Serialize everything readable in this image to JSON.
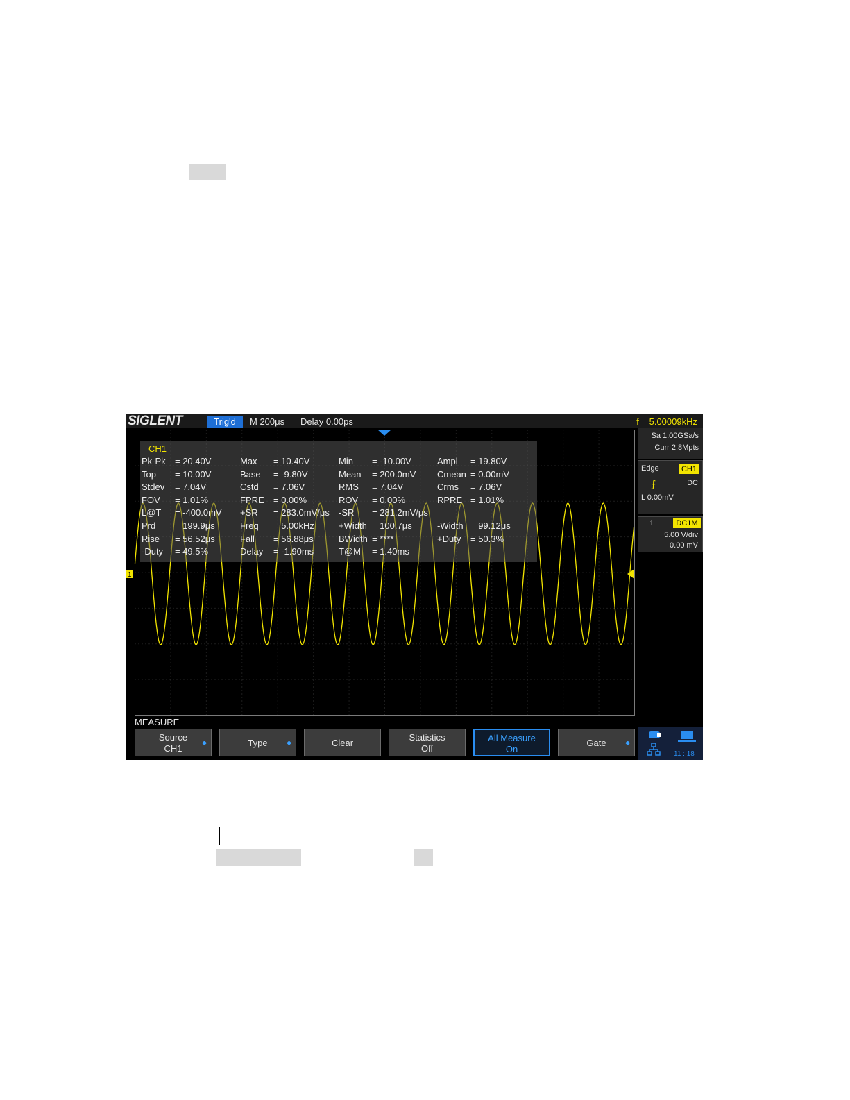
{
  "scope": {
    "logo": "SIGLENT",
    "trig_state": "Trig'd",
    "timebase": "M 200μs",
    "delay": "Delay 0.00ps",
    "frequency": "f = 5.00009kHz",
    "channel_marker": "1",
    "acquisition": {
      "sample_rate": "Sa 1.00GSa/s",
      "memory": "Curr 2.8Mpts"
    },
    "trigger": {
      "type": "Edge",
      "source": "CH1",
      "coupling": "DC",
      "level": "L  0.00mV"
    },
    "channel": {
      "number": "1",
      "coupling": "DC1M",
      "scale": "5.00 V/div",
      "offset": "0.00 mV"
    },
    "measure": {
      "title": "CH1",
      "rows": [
        [
          {
            "label": "Pk-Pk",
            "value": "= 20.40V"
          },
          {
            "label": "Max",
            "value": "= 10.40V"
          },
          {
            "label": "Min",
            "value": "= -10.00V"
          },
          {
            "label": "Ampl",
            "value": "= 19.80V"
          }
        ],
        [
          {
            "label": "Top",
            "value": "= 10.00V"
          },
          {
            "label": "Base",
            "value": "= -9.80V"
          },
          {
            "label": "Mean",
            "value": "= 200.0mV"
          },
          {
            "label": "Cmean",
            "value": "= 0.00mV"
          }
        ],
        [
          {
            "label": "Stdev",
            "value": "= 7.04V"
          },
          {
            "label": "Cstd",
            "value": "= 7.06V"
          },
          {
            "label": "RMS",
            "value": "= 7.04V"
          },
          {
            "label": "Crms",
            "value": "= 7.06V"
          }
        ],
        [
          {
            "label": "FOV",
            "value": "= 1.01%"
          },
          {
            "label": "FPRE",
            "value": "= 0.00%"
          },
          {
            "label": "ROV",
            "value": "= 0.00%"
          },
          {
            "label": "RPRE",
            "value": "= 1.01%"
          }
        ],
        [
          {
            "label": "L@T",
            "value": "= -400.0mV"
          },
          {
            "label": "+SR",
            "value": "= 283.0mV/μs"
          },
          {
            "label": "-SR",
            "value": "= 281.2mV/μs"
          },
          {
            "label": "",
            "value": ""
          }
        ],
        [
          {
            "label": "Prd",
            "value": "= 199.9μs"
          },
          {
            "label": "Freq",
            "value": "= 5.00kHz"
          },
          {
            "label": "+Width",
            "value": "= 100.7μs"
          },
          {
            "label": "-Width",
            "value": "= 99.12μs"
          }
        ],
        [
          {
            "label": "Rise",
            "value": "= 56.52μs"
          },
          {
            "label": "Fall",
            "value": "= 56.88μs"
          },
          {
            "label": "BWidth",
            "value": "= ****"
          },
          {
            "label": "+Duty",
            "value": "= 50.3%"
          }
        ],
        [
          {
            "label": "-Duty",
            "value": "= 49.5%"
          },
          {
            "label": "Delay",
            "value": "= -1.90ms"
          },
          {
            "label": "T@M",
            "value": "= 1.40ms"
          },
          {
            "label": "",
            "value": ""
          }
        ]
      ]
    },
    "menu": {
      "title": "MEASURE",
      "softkeys": [
        {
          "line1": "Source",
          "line2": "CH1",
          "arrow": "◆"
        },
        {
          "line1": "Type",
          "line2": "",
          "arrow": "◆"
        },
        {
          "line1": "Clear",
          "line2": "",
          "arrow": ""
        },
        {
          "line1": "Statistics",
          "line2": "Off",
          "arrow": ""
        },
        {
          "line1": "All Measure",
          "line2": "On",
          "arrow": ""
        },
        {
          "line1": "Gate",
          "line2": "",
          "arrow": "◆"
        }
      ]
    },
    "clock": "11 : 18",
    "colors": {
      "trace": "#f2e400",
      "grid": "#3a3a3a",
      "accent": "#2a8df0"
    }
  }
}
